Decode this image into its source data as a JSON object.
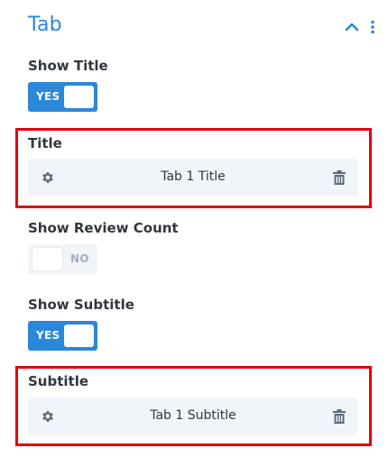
{
  "section": {
    "title": "Tab",
    "icons": {
      "collapse": "chevron-up-icon",
      "more": "more-vertical-icon"
    }
  },
  "fields": {
    "show_title": {
      "label": "Show Title",
      "toggle_text": "YES",
      "state": "on"
    },
    "title": {
      "label": "Title",
      "value": "Tab 1 Title"
    },
    "show_review_count": {
      "label": "Show Review Count",
      "toggle_text": "NO",
      "state": "off"
    },
    "show_subtitle": {
      "label": "Show Subtitle",
      "toggle_text": "YES",
      "state": "on"
    },
    "subtitle": {
      "label": "Subtitle",
      "value": "Tab 1 Subtitle"
    }
  },
  "row_icons": {
    "settings": "gear-icon",
    "delete": "trash-icon"
  },
  "colors": {
    "accent": "#2b87da",
    "highlight": "#e3000f",
    "row_bg": "#f1f5f9",
    "text": "#32373c",
    "muted": "#a3b0c2"
  }
}
